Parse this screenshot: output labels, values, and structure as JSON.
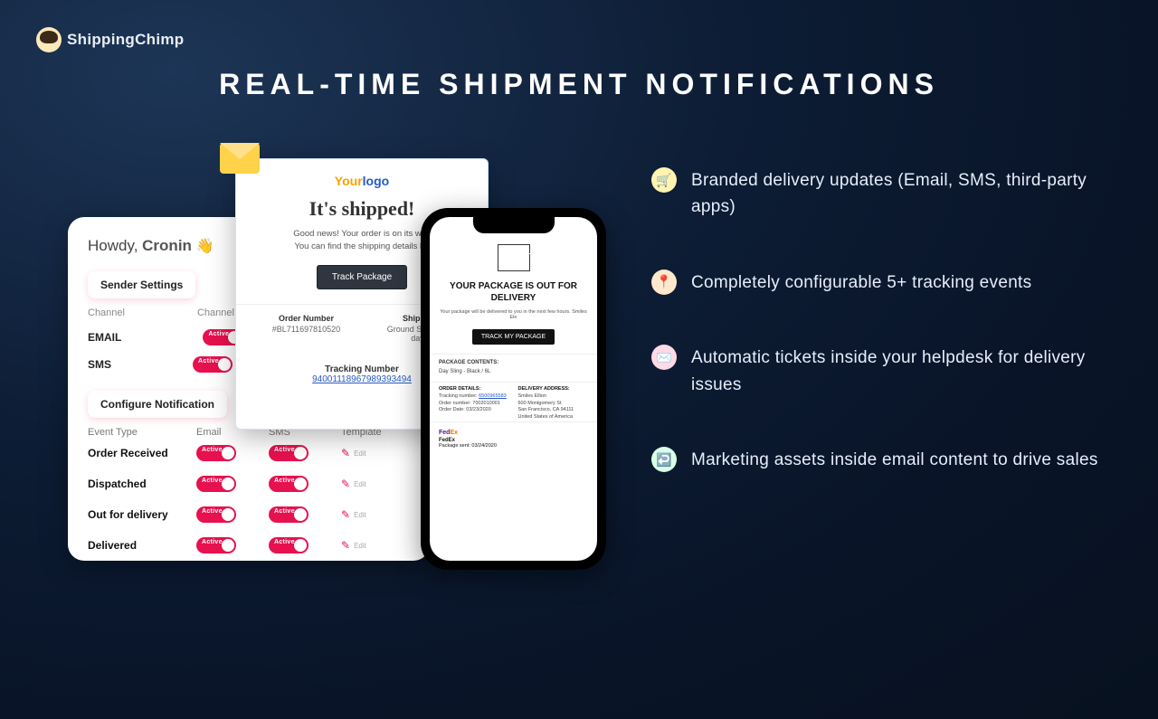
{
  "brand": "ShippingChimp",
  "title": "REAL-TIME SHIPMENT NOTIFICATIONS",
  "settings": {
    "howdy_prefix": "Howdy, ",
    "howdy_name": "Cronin",
    "wave": "👋",
    "sender_tab": "Sender Settings",
    "channel_label": "Channel",
    "channels": [
      {
        "name": "EMAIL"
      },
      {
        "name": "SMS"
      }
    ],
    "config_tab": "Configure Notification",
    "columns": {
      "event": "Event Type",
      "email": "Email",
      "sms": "SMS",
      "template": "Template"
    },
    "events": [
      {
        "name": "Order Received",
        "template": "Edit"
      },
      {
        "name": "Dispatched",
        "template": "Edit"
      },
      {
        "name": "Out for delivery",
        "template": "Edit"
      },
      {
        "name": "Delivered",
        "template": "Edit"
      }
    ]
  },
  "email": {
    "logo_a": "Your",
    "logo_b": "logo",
    "headline": "It's shipped!",
    "line1": "Good news! Your order is on its way",
    "line2": "You can find the shipping details be",
    "track_btn": "Track Package",
    "order_label": "Order Number",
    "order_value": "#BL711697810520",
    "ship_label": "Shippin",
    "ship_value": "Ground Shipping\nday",
    "track_label": "Tracking Number",
    "track_value": "94001118967989393494"
  },
  "phone": {
    "title": "YOUR PACKAGE IS OUT FOR DELIVERY",
    "sub": "Your package will be delivered to you in the next few hours. Smiles Ele",
    "btn": "TRACK MY PACKAGE",
    "contents_label": "PACKAGE CONTENTS:",
    "item": "Day Sling - Black / 6L",
    "order_head": "ORDER DETAILS:",
    "track_label": "Tracking number:",
    "track_val": "6500965583",
    "ordnum_label": "Order number:",
    "ordnum_val": "7002010001",
    "date_label": "Order Date:",
    "date_val": "03/23/2020",
    "deliv_head": "DELIVERY ADDRESS:",
    "address": "Smiles Ellion\n600 Montgomery St\nSan Francisco, CA 94111\nUnited States of America",
    "carrier_a": "Fed",
    "carrier_b": "Ex",
    "carrier_name": "FedEx",
    "sent_label": "Package sent:",
    "sent_val": "03/24/2020"
  },
  "features": [
    {
      "icon": "🛒",
      "text": "Branded delivery updates (Email, SMS, third-party apps)"
    },
    {
      "icon": "📍",
      "text": "Completely configurable 5+ tracking events"
    },
    {
      "icon": "✉️",
      "text": "Automatic tickets inside your helpdesk for delivery issues"
    },
    {
      "icon": "↩️",
      "text": "Marketing assets inside email content to drive sales"
    }
  ]
}
